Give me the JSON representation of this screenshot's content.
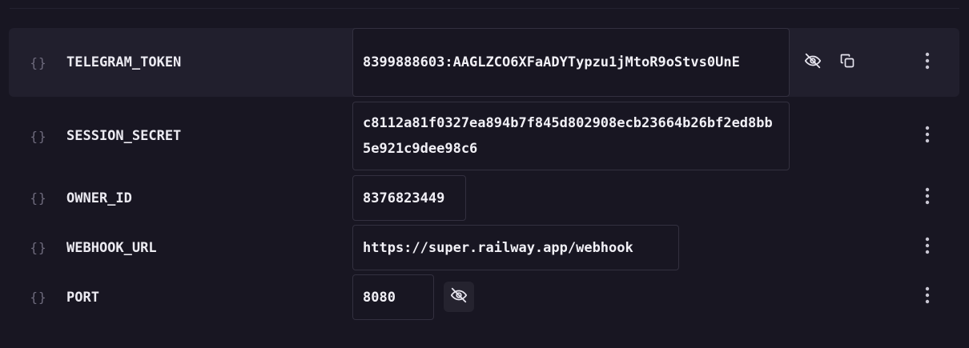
{
  "variables": [
    {
      "type_icon": "{}",
      "name": "TELEGRAM_TOKEN",
      "value": "8399888603:AAGLZCO6XFaADYTypzu1jMtoR9oStvs0UnE",
      "actions": [
        "eye-off-icon",
        "copy-icon",
        "more-vertical-icon"
      ]
    },
    {
      "type_icon": "{}",
      "name": "SESSION_SECRET",
      "value": "c8112a81f0327ea894b7f845d802908ecb23664b26bf2ed8bb5e921c9dee98c6",
      "actions": [
        "more-vertical-icon"
      ]
    },
    {
      "type_icon": "{}",
      "name": "OWNER_ID",
      "value": "8376823449",
      "actions": [
        "more-vertical-icon"
      ]
    },
    {
      "type_icon": "{}",
      "name": "WEBHOOK_URL",
      "value": "https://super.railway.app/webhook",
      "actions": [
        "more-vertical-icon"
      ]
    },
    {
      "type_icon": "{}",
      "name": "PORT",
      "value": "8080",
      "actions": [
        "eye-off-icon",
        "more-vertical-icon"
      ]
    }
  ],
  "colors": {
    "background": "#181622",
    "row_hover": "#211f2d",
    "border": "#33303f",
    "muted_icon": "#6e6b7d",
    "text": "#ecebf2"
  }
}
